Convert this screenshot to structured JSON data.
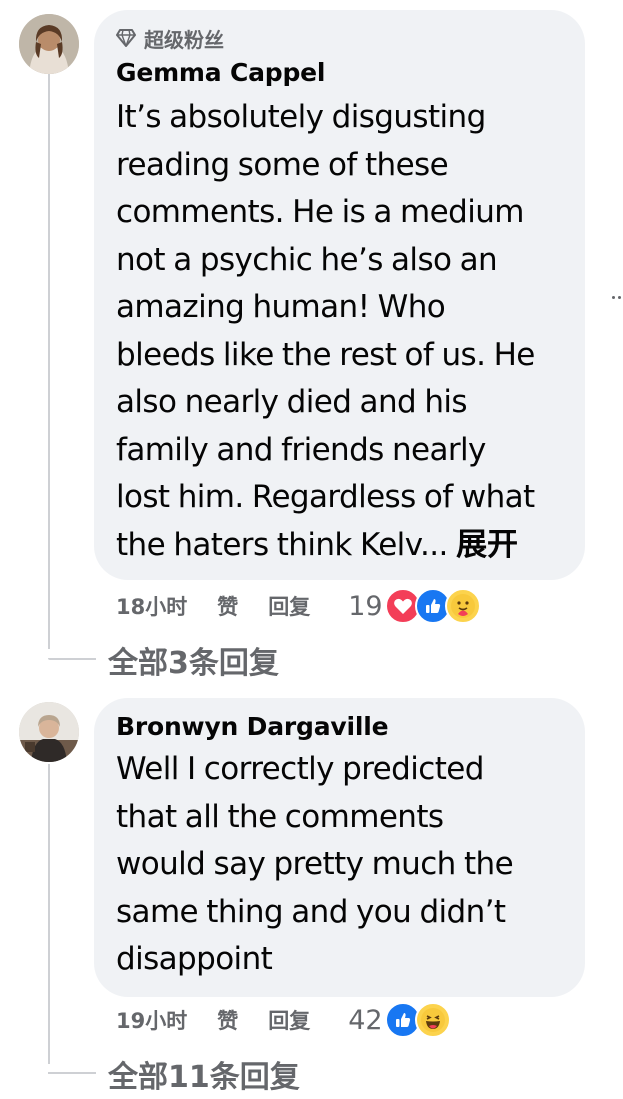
{
  "comments": [
    {
      "badge": "超级粉丝",
      "author": "Gemma Cappel",
      "lines": [
        "It’s absolutely disgusting",
        "reading some of these",
        "comments. He is a medium",
        "not a psychic he’s also an",
        "amazing human! Who",
        "bleeds like the rest of us. He",
        "also nearly died and his",
        "family and friends nearly",
        "lost him. Regardless of what",
        "the haters think Kelv..."
      ],
      "expand_label": "展开",
      "time": "18小时",
      "like_label": "赞",
      "reply_label": "回复",
      "reaction_count": "19",
      "reactions": [
        "love-icon",
        "like-icon",
        "care-icon"
      ],
      "view_replies": "全部3条回复"
    },
    {
      "author": "Bronwyn Dargaville",
      "lines": [
        "Well I correctly predicted",
        "that all the comments",
        "would say pretty much the",
        "same thing and you didn’t",
        "disappoint"
      ],
      "time": "19小时",
      "like_label": "赞",
      "reply_label": "回复",
      "reaction_count": "42",
      "reactions": [
        "like-icon",
        "haha-icon"
      ],
      "view_replies": "全部11条回复"
    }
  ],
  "colors": {
    "bubble": "#f0f2f5",
    "meta": "#65676b",
    "like_blue": "#1877f2",
    "love_red": "#f33e58",
    "emoji_yellow": "#fcd34d"
  }
}
